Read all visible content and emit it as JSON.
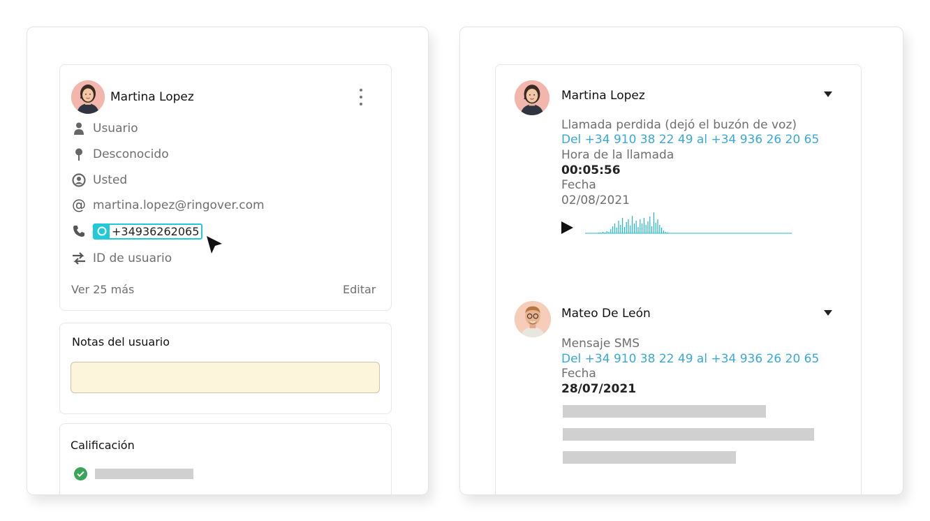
{
  "contact": {
    "name": "Martina Lopez",
    "rows": {
      "role": "Usuario",
      "location": "Desconocido",
      "owner": "Usted",
      "email": "martina.lopez@ringover.com",
      "phone": "+34936262065",
      "user_id": "ID de usuario"
    },
    "see_more": "Ver 25 más",
    "edit": "Editar"
  },
  "notes": {
    "title": "Notas del usuario",
    "value": ""
  },
  "rating": {
    "title": "Calificación"
  },
  "activity": [
    {
      "name": "Martina Lopez",
      "type": "Llamada perdida (dejó el buzón de voz)",
      "route": "Del +34 910 38 22 49 al +34 936 26 20 65",
      "time_label": "Hora de la llamada",
      "time_value": "00:05:56",
      "date_label": "Fecha",
      "date_value": "02/08/2021"
    },
    {
      "name": "Mateo De León",
      "type": "Mensaje SMS",
      "route": "Del +34 910 38 22 49 al +34 936 26 20 65",
      "date_label": "Fecha",
      "date_value": "28/07/2021"
    }
  ],
  "colors": {
    "accent_cyan": "#22c9d6",
    "link_blue": "#3aa8d8",
    "note_bg": "#fdf5db",
    "success_green": "#3aa55a",
    "skeleton_gray": "#d0d0d0"
  },
  "icons": [
    "person-icon",
    "location-pin-icon",
    "owner-icon",
    "at-icon",
    "phone-icon",
    "transfer-icon",
    "more-vertical-icon",
    "caret-down-icon",
    "play-icon",
    "check-circle-icon",
    "cursor-icon"
  ]
}
